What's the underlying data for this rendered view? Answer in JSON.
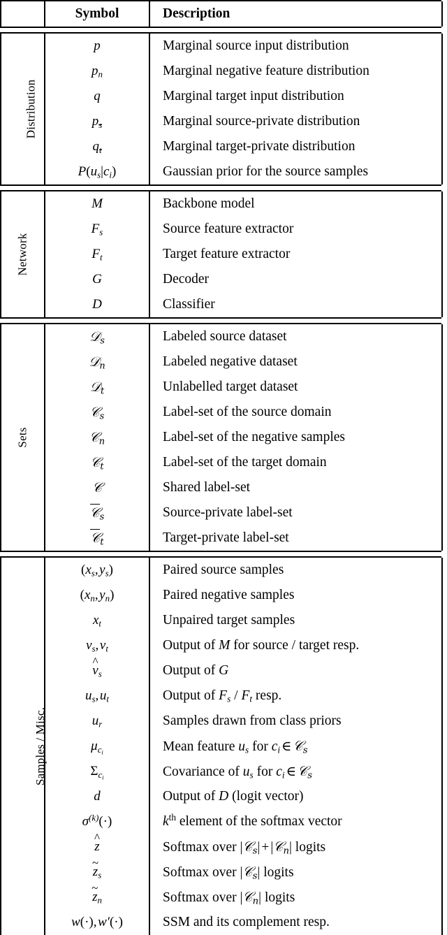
{
  "table": {
    "columns": {
      "group_header": "",
      "symbol_header": "Symbol",
      "description_header": "Description"
    },
    "sections": [
      {
        "label": "Distribution",
        "rows": [
          {
            "symbol": "p",
            "description": "Marginal source input distribution"
          },
          {
            "symbol": "p_n",
            "description": "Marginal negative feature distribution"
          },
          {
            "symbol": "q",
            "description": "Marginal target input distribution"
          },
          {
            "symbol": "p_sbar",
            "description": "Marginal source-private distribution"
          },
          {
            "symbol": "q_tbar",
            "description": "Marginal target-private distribution"
          },
          {
            "symbol": "P(u_s|c_i)",
            "description": "Gaussian prior for the source samples"
          }
        ]
      },
      {
        "label": "Network",
        "rows": [
          {
            "symbol": "M",
            "description": "Backbone model"
          },
          {
            "symbol": "F_s",
            "description": "Source feature extractor"
          },
          {
            "symbol": "F_t",
            "description": "Target feature extractor"
          },
          {
            "symbol": "G",
            "description": "Decoder"
          },
          {
            "symbol": "D",
            "description": "Classifier"
          }
        ]
      },
      {
        "label": "Sets",
        "rows": [
          {
            "symbol": "D_s",
            "description": "Labeled source dataset"
          },
          {
            "symbol": "D_n",
            "description": "Labeled negative dataset"
          },
          {
            "symbol": "D_t",
            "description": "Unlabelled target dataset"
          },
          {
            "symbol": "C_s",
            "description": "Label-set of the source domain"
          },
          {
            "symbol": "C_n",
            "description": "Label-set of the negative samples"
          },
          {
            "symbol": "C_t",
            "description": "Label-set of the target domain"
          },
          {
            "symbol": "C",
            "description": "Shared label-set"
          },
          {
            "symbol": "Cbar_s",
            "description": "Source-private label-set"
          },
          {
            "symbol": "Cbar_t",
            "description": "Target-private label-set"
          }
        ]
      },
      {
        "label": "Samples / Misc.",
        "rows": [
          {
            "symbol": "(x_s, y_s)",
            "description": "Paired source samples"
          },
          {
            "symbol": "(x_n, y_n)",
            "description": "Paired negative samples"
          },
          {
            "symbol": "x_t",
            "description": "Unpaired target samples"
          },
          {
            "symbol": "v_s, v_t",
            "description": "Output of M for source / target resp."
          },
          {
            "symbol": "vhat_s",
            "description": "Output of G"
          },
          {
            "symbol": "u_s, u_t",
            "description": "Output of F_s / F_t resp."
          },
          {
            "symbol": "u_r",
            "description": "Samples drawn from class priors"
          },
          {
            "symbol": "mu_ci",
            "description": "Mean feature u_s for c_i in C_s"
          },
          {
            "symbol": "Sigma_ci",
            "description": "Covariance of u_s for c_i in C_s"
          },
          {
            "symbol": "d",
            "description": "Output of D (logit vector)"
          },
          {
            "symbol": "sigma^(k)(.)",
            "description": "k-th element of the softmax vector"
          },
          {
            "symbol": "zhat",
            "description": "Softmax over |C_s| + |C_n| logits"
          },
          {
            "symbol": "ztilde_s",
            "description": "Softmax over |C_s| logits"
          },
          {
            "symbol": "ztilde_n",
            "description": "Softmax over |C_n| logits"
          },
          {
            "symbol": "w(.), w'(.)",
            "description": "SSM and its complement resp."
          }
        ]
      }
    ]
  },
  "colors": {
    "rule": "#000000",
    "text": "#000000",
    "background": "#ffffff"
  }
}
